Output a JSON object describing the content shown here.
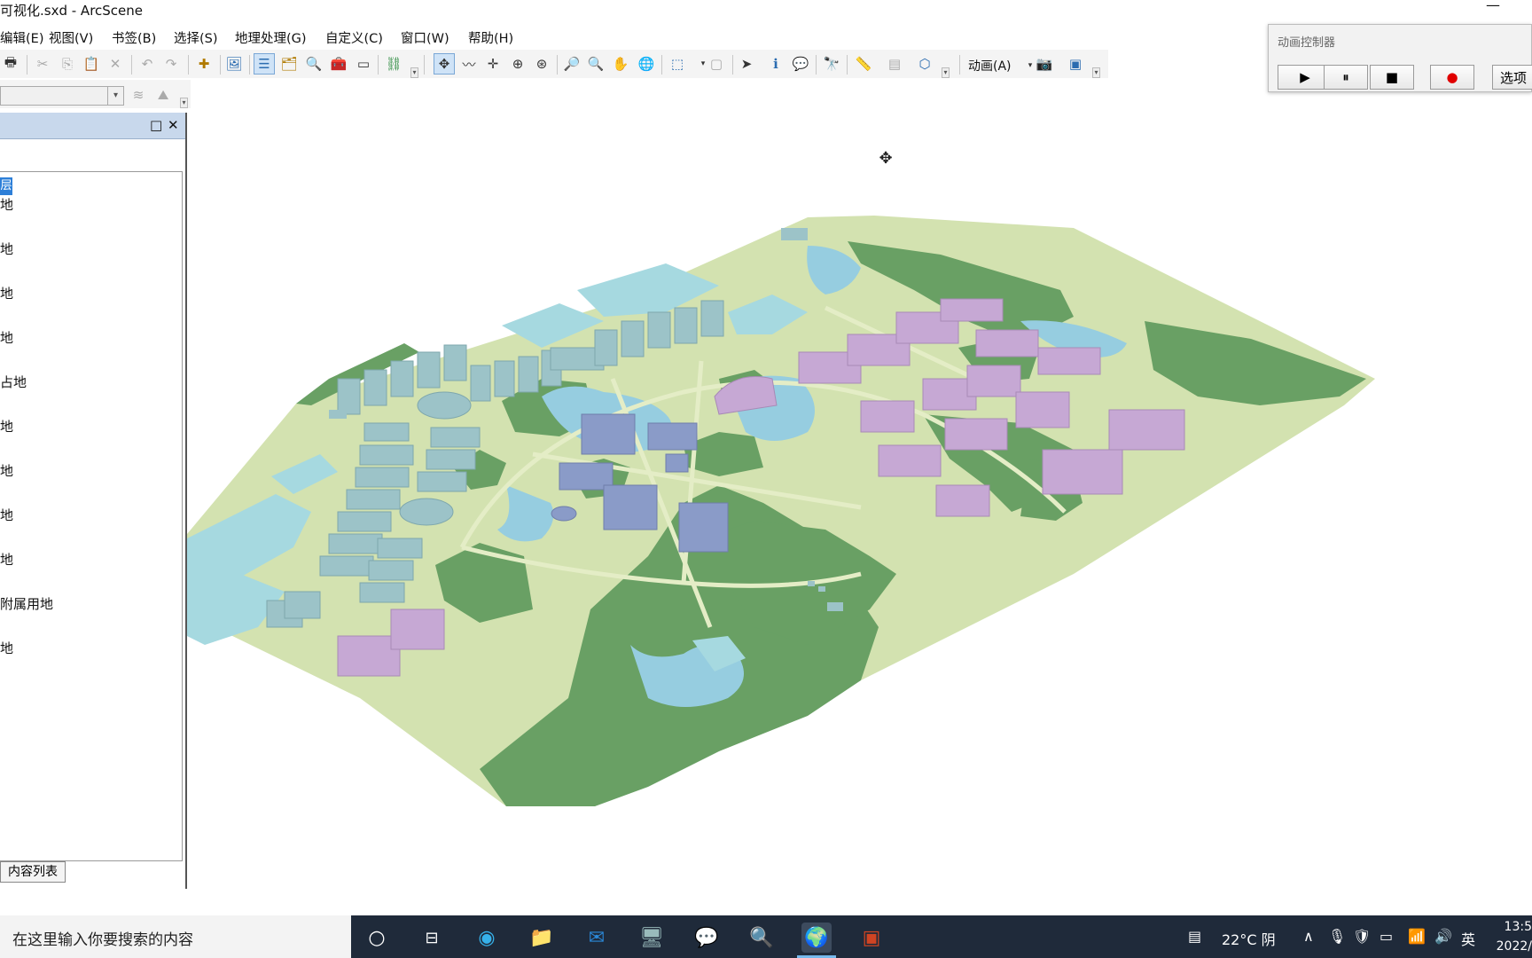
{
  "window": {
    "title": "可视化.sxd - ArcScene",
    "minimize_glyph": "—"
  },
  "menubar": {
    "items": [
      "编辑(E)",
      "视图(V)",
      "书签(B)",
      "选择(S)",
      "地理处理(G)",
      "自定义(C)",
      "窗口(W)",
      "帮助(H)"
    ]
  },
  "toolbar": {
    "animation_menu": "动画(A)",
    "icons": [
      "print-icon",
      "cut-icon",
      "copy-icon",
      "paste-icon",
      "delete-icon",
      "undo-icon",
      "redo-icon",
      "add-data-icon",
      "scene-icon",
      "toc-window-icon",
      "catalog-icon",
      "search-icon",
      "arctoolbox-icon",
      "python-icon",
      "model-builder-icon",
      "navigate-icon",
      "fly-icon",
      "center-target-icon",
      "zoom-target-icon",
      "set-observer-icon",
      "zoom-in-icon",
      "zoom-out-icon",
      "pan-icon",
      "full-extent-icon",
      "select-features-icon",
      "clear-selection-icon",
      "select-elements-icon",
      "identify-icon",
      "html-popup-icon",
      "find-icon",
      "measure-icon",
      "layer-properties-icon",
      "3d-effects-icon",
      "capture-icon",
      "animation-manager-icon"
    ]
  },
  "toc": {
    "root_label": "层",
    "items": [
      "地",
      "地",
      "地",
      "地",
      "占地",
      "地",
      "地",
      "地",
      "地",
      "附属用地",
      "地"
    ],
    "tab_label": "内容列表"
  },
  "animation_controller": {
    "title": "动画控制器",
    "buttons": {
      "play": "▶",
      "pause": "⏸",
      "stop": "■",
      "record": "●",
      "options": "选项"
    }
  },
  "scene": {
    "navigation_cursor": "✥",
    "colors": {
      "ground": "#d3e2b0",
      "green_space": "#69a064",
      "water": "#96cde0",
      "blue_lot": "#a6d9e0",
      "teaching_buildings": "#8a9bc8",
      "dorm_buildings": "#c6a8d4",
      "lab_buildings": "#9cc3c8"
    }
  },
  "taskbar": {
    "search_placeholder": "在这里输入你要搜索的内容",
    "weather": "22°C  阴",
    "ime": "英",
    "time": "13:5",
    "date": "2022/",
    "apps": [
      "cortana-icon",
      "task-view-icon",
      "edge-icon",
      "file-explorer-icon",
      "outlook-icon",
      "remote-desktop-icon",
      "wechat-icon",
      "arcgis-catalog-icon",
      "arcscene-icon",
      "powerpoint-icon"
    ]
  }
}
